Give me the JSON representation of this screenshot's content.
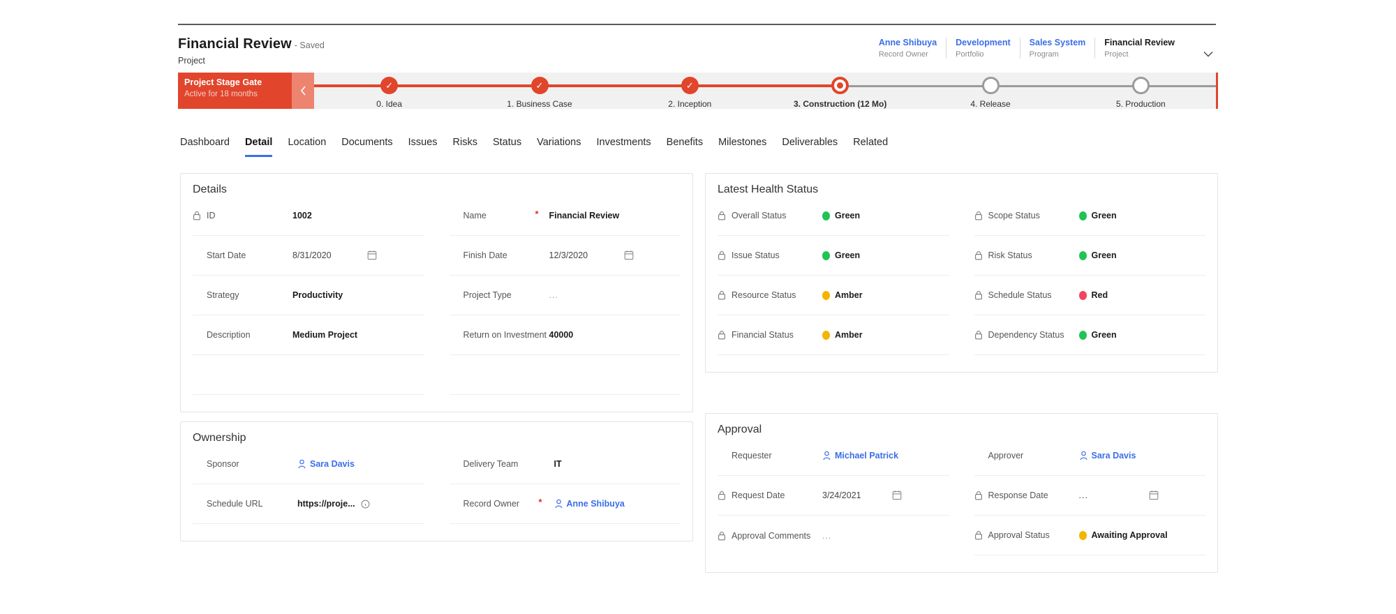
{
  "header": {
    "record_title": "Financial Review",
    "saved_text": "- Saved",
    "record_type": "Project",
    "breadcrumbs": [
      {
        "name": "Anne Shibuya",
        "role": "Record Owner",
        "current": false
      },
      {
        "name": "Development",
        "role": "Portfolio",
        "current": false
      },
      {
        "name": "Sales System",
        "role": "Program",
        "current": false
      },
      {
        "name": "Financial Review",
        "role": "Project",
        "current": true
      }
    ],
    "chevron_icon": "chevron-down-icon"
  },
  "stage_gate": {
    "label_title": "Project Stage Gate",
    "label_sub": "Active for 18 months",
    "back_icon": "chevron-left-icon",
    "accent_color": "#e1452c",
    "stages": [
      {
        "label": "0. Idea",
        "state": "done"
      },
      {
        "label": "1. Business Case",
        "state": "done"
      },
      {
        "label": "2. Inception",
        "state": "done"
      },
      {
        "label": "3. Construction  (12 Mo)",
        "state": "current"
      },
      {
        "label": "4. Release",
        "state": "todo"
      },
      {
        "label": "5. Production",
        "state": "todo"
      }
    ]
  },
  "tabs": {
    "active_index": 1,
    "accent_color": "#3a6ee8",
    "items": [
      "Dashboard",
      "Detail",
      "Location",
      "Documents",
      "Issues",
      "Risks",
      "Status",
      "Variations",
      "Investments",
      "Benefits",
      "Milestones",
      "Deliverables",
      "Related"
    ]
  },
  "cards": {
    "details": {
      "title": "Details",
      "rows_left": [
        {
          "label": "ID",
          "value": "1002",
          "locked": true,
          "type": "text"
        },
        {
          "label": "Start Date",
          "value": "8/31/2020",
          "locked": false,
          "type": "date"
        },
        {
          "label": "Strategy",
          "value": "Productivity",
          "locked": false,
          "type": "text"
        },
        {
          "label": "Description",
          "value": "Medium Project",
          "locked": false,
          "type": "text"
        },
        {
          "label": "",
          "value": "",
          "locked": false,
          "type": "blank"
        }
      ],
      "rows_right": [
        {
          "label": "Name",
          "value": "Financial Review",
          "locked": false,
          "type": "text",
          "required": true
        },
        {
          "label": "Finish Date",
          "value": "12/3/2020",
          "locked": false,
          "type": "date"
        },
        {
          "label": "Project Type",
          "value": "...",
          "locked": false,
          "type": "empty"
        },
        {
          "label": "Return on Investment",
          "value": "40000",
          "locked": false,
          "type": "text"
        },
        {
          "label": "",
          "value": "",
          "locked": false,
          "type": "blank"
        }
      ]
    },
    "health": {
      "title": "Latest Health Status",
      "rows_left": [
        {
          "label": "Overall Status",
          "value": "Green",
          "color": "#21c355",
          "locked": true
        },
        {
          "label": "Issue Status",
          "value": "Green",
          "color": "#21c355",
          "locked": true
        },
        {
          "label": "Resource Status",
          "value": "Amber",
          "color": "#f4b400",
          "locked": true
        },
        {
          "label": "Financial Status",
          "value": "Amber",
          "color": "#f4b400",
          "locked": true
        }
      ],
      "rows_right": [
        {
          "label": "Scope Status",
          "value": "Green",
          "color": "#21c355",
          "locked": true
        },
        {
          "label": "Risk Status",
          "value": "Green",
          "color": "#21c355",
          "locked": true
        },
        {
          "label": "Schedule Status",
          "value": "Red",
          "color": "#f4425f",
          "locked": true
        },
        {
          "label": "Dependency Status",
          "value": "Green",
          "color": "#21c355",
          "locked": true
        }
      ]
    },
    "ownership": {
      "title": "Ownership",
      "rows_left": [
        {
          "label": "Sponsor",
          "value": "Sara Davis",
          "locked": false,
          "type": "person"
        },
        {
          "label": "Schedule URL",
          "value": "https://proje...",
          "locked": false,
          "type": "url"
        }
      ],
      "rows_right": [
        {
          "label": "Delivery Team",
          "value": "IT",
          "locked": false,
          "type": "text"
        },
        {
          "label": "Record Owner",
          "value": "Anne Shibuya",
          "locked": false,
          "type": "person",
          "required": true
        }
      ]
    },
    "approval": {
      "title": "Approval",
      "rows_left": [
        {
          "label": "Requester",
          "value": "Michael Patrick",
          "locked": false,
          "type": "person"
        },
        {
          "label": "Request Date",
          "value": "3/24/2021",
          "locked": true,
          "type": "date"
        },
        {
          "label": "Approval Comments",
          "value": "...",
          "locked": true,
          "type": "empty"
        }
      ],
      "rows_right": [
        {
          "label": "Approver",
          "value": "Sara Davis",
          "locked": false,
          "type": "person"
        },
        {
          "label": "Response Date",
          "value": "...",
          "locked": true,
          "type": "date-empty"
        },
        {
          "label": "Approval Status",
          "value": "Awaiting Approval",
          "locked": true,
          "type": "status",
          "color": "#f4b400"
        }
      ]
    }
  },
  "icons": {
    "lock": "lock-icon",
    "calendar": "calendar-icon",
    "person": "person-icon",
    "info": "info-icon"
  }
}
